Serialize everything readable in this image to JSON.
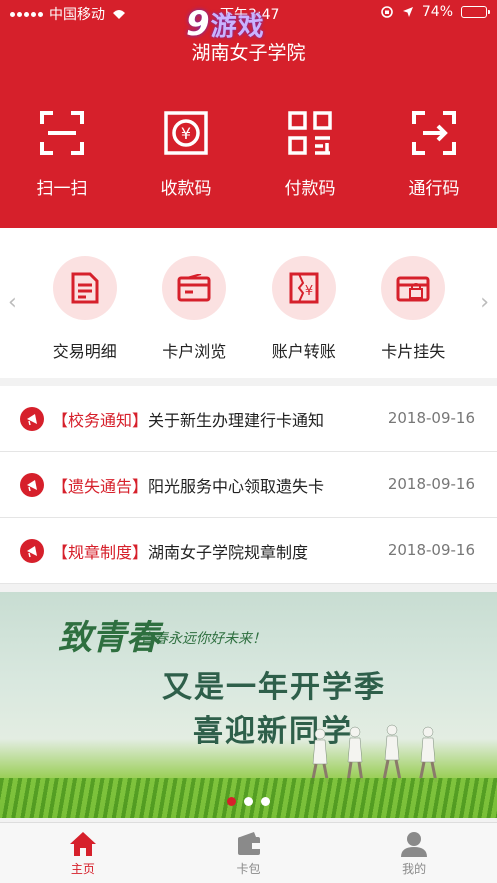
{
  "status_bar": {
    "carrier": "中国移动",
    "time": "下午3:47",
    "battery": "74%",
    "battery_level": 0.74
  },
  "watermark": {
    "number": "9",
    "text": "游戏"
  },
  "header": {
    "title": "湖南女子学院"
  },
  "quick_actions": [
    {
      "label": "扫一扫",
      "icon": "scan-icon"
    },
    {
      "label": "收款码",
      "icon": "receive-qr-icon"
    },
    {
      "label": "付款码",
      "icon": "pay-qr-icon"
    },
    {
      "label": "通行码",
      "icon": "pass-code-icon"
    }
  ],
  "services": [
    {
      "label": "交易明细",
      "icon": "transaction-detail-icon"
    },
    {
      "label": "卡户浏览",
      "icon": "card-browse-icon"
    },
    {
      "label": "账户转账",
      "icon": "account-transfer-icon"
    },
    {
      "label": "卡片挂失",
      "icon": "card-loss-icon"
    }
  ],
  "notices": [
    {
      "tag": "【校务通知】",
      "title": "关于新生办理建行卡通知",
      "date": "2018-09-16"
    },
    {
      "tag": "【遗失通告】",
      "title": "阳光服务中心领取遗失卡",
      "date": "2018-09-16"
    },
    {
      "tag": "【规章制度】",
      "title": "湖南女子学院规章制度",
      "date": "2018-09-16"
    }
  ],
  "banner": {
    "script_title": "致青春",
    "script_sub": "青春永远你好未来！",
    "headline_1": "又是一年开学季",
    "headline_2": "喜迎新同学",
    "slide_count": 3,
    "active_slide": 1
  },
  "tabbar": [
    {
      "label": "主页",
      "icon": "home-icon",
      "active": true
    },
    {
      "label": "卡包",
      "icon": "wallet-icon",
      "active": false
    },
    {
      "label": "我的",
      "icon": "profile-icon",
      "active": false
    }
  ],
  "colors": {
    "primary": "#d6202b",
    "service_circle": "#fbe1e1"
  }
}
